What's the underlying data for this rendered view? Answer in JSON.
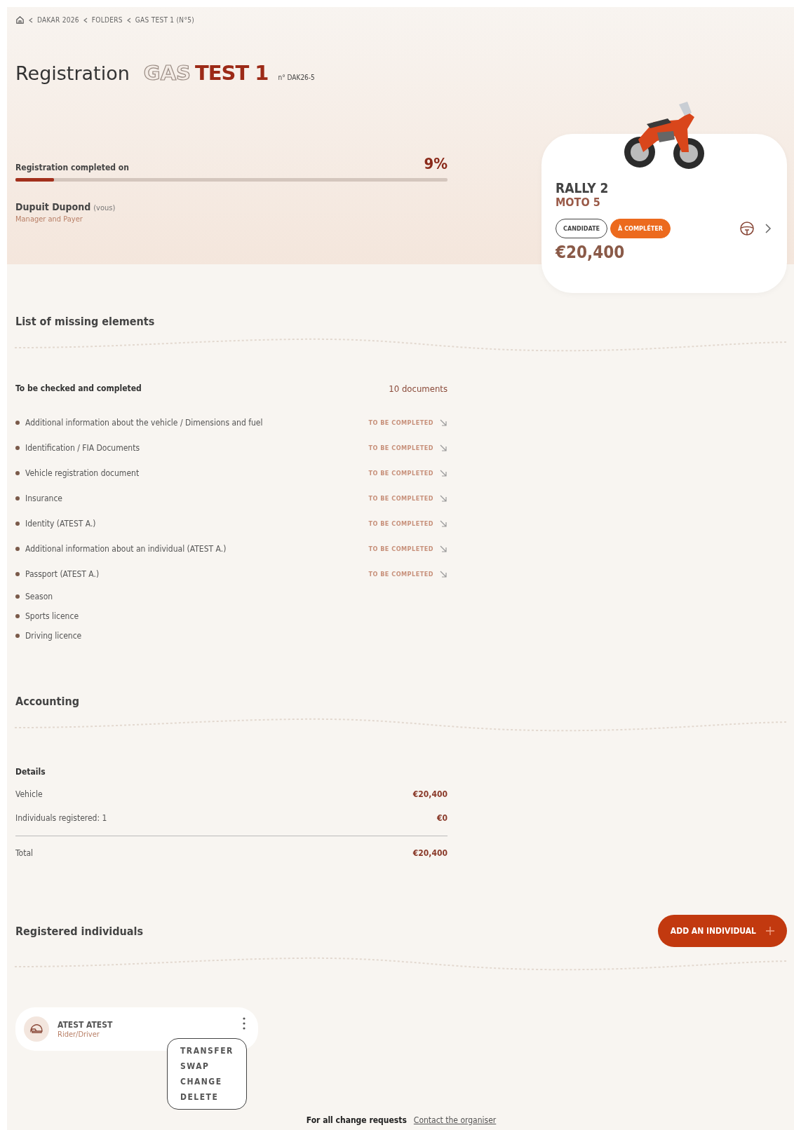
{
  "breadcrumb": [
    "DAKAR 2026",
    "FOLDERS",
    "GAS TEST 1 (N°5)"
  ],
  "title": {
    "heading": "Registration",
    "outline_word": "GAS",
    "bold_word": "TEST 1",
    "number": "n° DAK26-5"
  },
  "progress": {
    "label": "Registration completed on",
    "percent": "9%",
    "level": 0.09
  },
  "owner": {
    "name": "Dupuit Dupond",
    "note": "(vous)",
    "role": "Manager and Payer"
  },
  "vehicle_card": {
    "model": "RALLY 2",
    "category": "MOTO 5",
    "badges": [
      {
        "label": "CANDIDATE",
        "kind": "outline"
      },
      {
        "label": "À COMPLÉTER",
        "kind": "filled"
      }
    ],
    "price": "€20,400"
  },
  "missing": {
    "title": "List of missing elements",
    "subtitle": "To be checked and completed",
    "count": "10 documents",
    "items": [
      {
        "name": "Additional information about the vehicle / Dimensions and fuel",
        "status": "TO BE COMPLETED"
      },
      {
        "name": "Identification / FIA Documents",
        "status": "TO BE COMPLETED"
      },
      {
        "name": "Vehicle registration document",
        "status": "TO BE COMPLETED"
      },
      {
        "name": "Insurance",
        "status": "TO BE COMPLETED"
      },
      {
        "name": "Identity (ATEST A.)",
        "status": "TO BE COMPLETED"
      },
      {
        "name": "Additional information about an individual (ATEST A.)",
        "status": "TO BE COMPLETED"
      },
      {
        "name": "Passport (ATEST A.)",
        "status": "TO BE COMPLETED"
      },
      {
        "name": "Season"
      },
      {
        "name": "Sports licence"
      },
      {
        "name": "Driving licence"
      }
    ]
  },
  "accounting": {
    "title": "Accounting",
    "subtitle": "Details",
    "lines": [
      {
        "label": "Vehicle",
        "amount": "€20,400"
      },
      {
        "label": "Individuals registered: 1",
        "amount": "€0"
      }
    ],
    "total": {
      "label": "Total",
      "amount": "€20,400"
    }
  },
  "individuals": {
    "title": "Registered individuals",
    "add_button": "ADD AN INDIVIDUAL",
    "people": [
      {
        "name": "ATEST ATEST",
        "role": "Rider/Driver",
        "menu_open": true
      }
    ],
    "menu": [
      "TRANSFER",
      "SWAP",
      "CHANGE",
      "DELETE"
    ]
  },
  "footer": {
    "text": "For all change requests",
    "link": "Contact the organiser"
  }
}
